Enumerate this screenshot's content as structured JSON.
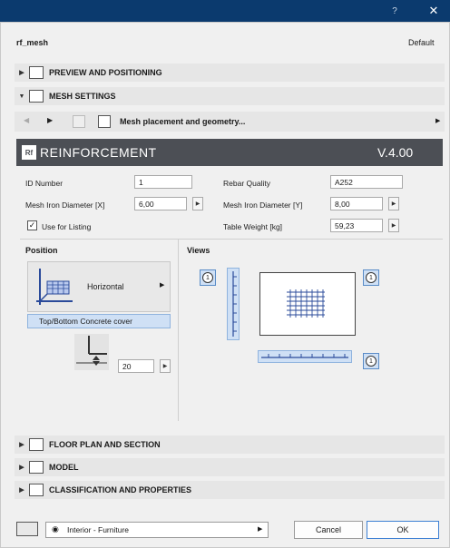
{
  "window": {
    "help_label": "?",
    "close_label": "✕"
  },
  "header": {
    "title": "rf_mesh",
    "mode": "Default"
  },
  "sections": {
    "preview": "PREVIEW AND POSITIONING",
    "mesh": "MESH SETTINGS",
    "floor": "FLOOR PLAN AND SECTION",
    "model": "MODEL",
    "classification": "CLASSIFICATION AND PROPERTIES"
  },
  "toolbar": {
    "page_label": "Mesh placement and geometry..."
  },
  "banner": {
    "title": "REINFORCEMENT",
    "version": "V.4.00",
    "logo": "Rf"
  },
  "fields": {
    "id_number": {
      "label": "ID Number",
      "value": "1"
    },
    "mesh_x": {
      "label": "Mesh Iron Diameter [X]",
      "value": "6,00"
    },
    "use_listing": {
      "label": "Use for Listing",
      "checked": true
    },
    "rebar_quality": {
      "label": "Rebar Quality",
      "value": "A252"
    },
    "mesh_y": {
      "label": "Mesh Iron Diameter [Y]",
      "value": "8,00"
    },
    "table_weight": {
      "label": "Table Weight [kg]",
      "value": "59,23"
    }
  },
  "position": {
    "title": "Position",
    "orientation": "Horizontal",
    "cover_label": "Top/Bottom Concrete cover",
    "cover_value": "20"
  },
  "views": {
    "title": "Views",
    "badge": "1"
  },
  "footer": {
    "layer_label": "Interior - Furniture",
    "cancel_label": "Cancel",
    "ok_label": "OK"
  },
  "colors": {
    "titlebar": "#0b3a6e",
    "banner": "#4c4f55",
    "accent_blue": "#cfe0f5"
  }
}
